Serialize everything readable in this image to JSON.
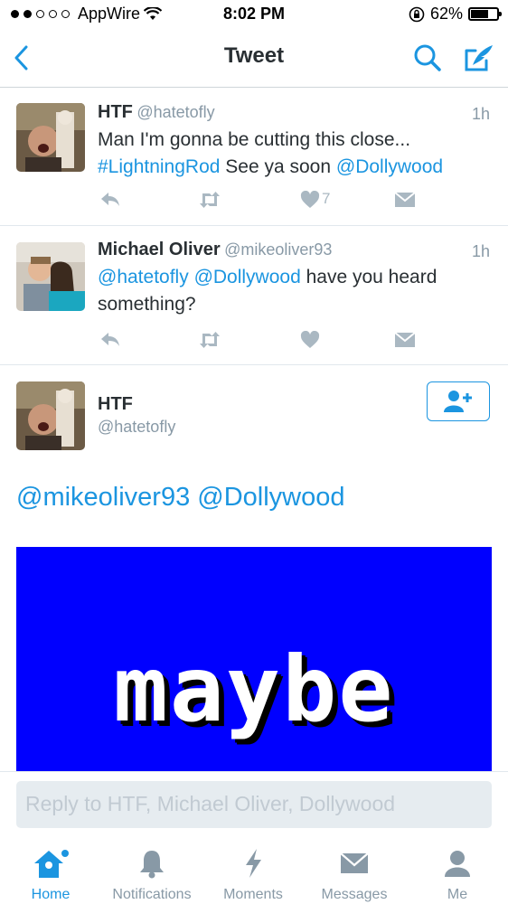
{
  "status_bar": {
    "carrier": "AppWire",
    "time": "8:02 PM",
    "battery": "62%",
    "battery_level": 0.62
  },
  "nav": {
    "title": "Tweet"
  },
  "tweets": [
    {
      "name": "HTF",
      "handle": "@hatetofly",
      "time": "1h",
      "line1": "Man I'm gonna be cutting this close...",
      "hashtag": "#LightningRod",
      "mid": " See ya soon ",
      "mention": "@Dollywood",
      "likes": "7"
    },
    {
      "name": "Michael Oliver",
      "handle": "@mikeoliver93",
      "time": "1h",
      "mention1": "@hatetofly",
      "mention2": "@Dollywood",
      "rest1": " have you heard",
      "line2": "something?"
    }
  ],
  "focus_tweet": {
    "name": "HTF",
    "handle": "@hatetofly",
    "text": "@mikeoliver93 @Dollywood",
    "gif_text": "maybe"
  },
  "reply": {
    "placeholder": "Reply to HTF, Michael Oliver, Dollywood"
  },
  "tabs": [
    {
      "label": "Home",
      "icon": "home-icon"
    },
    {
      "label": "Notifications",
      "icon": "bell-icon"
    },
    {
      "label": "Moments",
      "icon": "lightning-icon"
    },
    {
      "label": "Messages",
      "icon": "envelope-icon"
    },
    {
      "label": "Me",
      "icon": "person-icon"
    }
  ],
  "colors": {
    "accent": "#1b95e0",
    "gif_background": "#0000ff"
  }
}
